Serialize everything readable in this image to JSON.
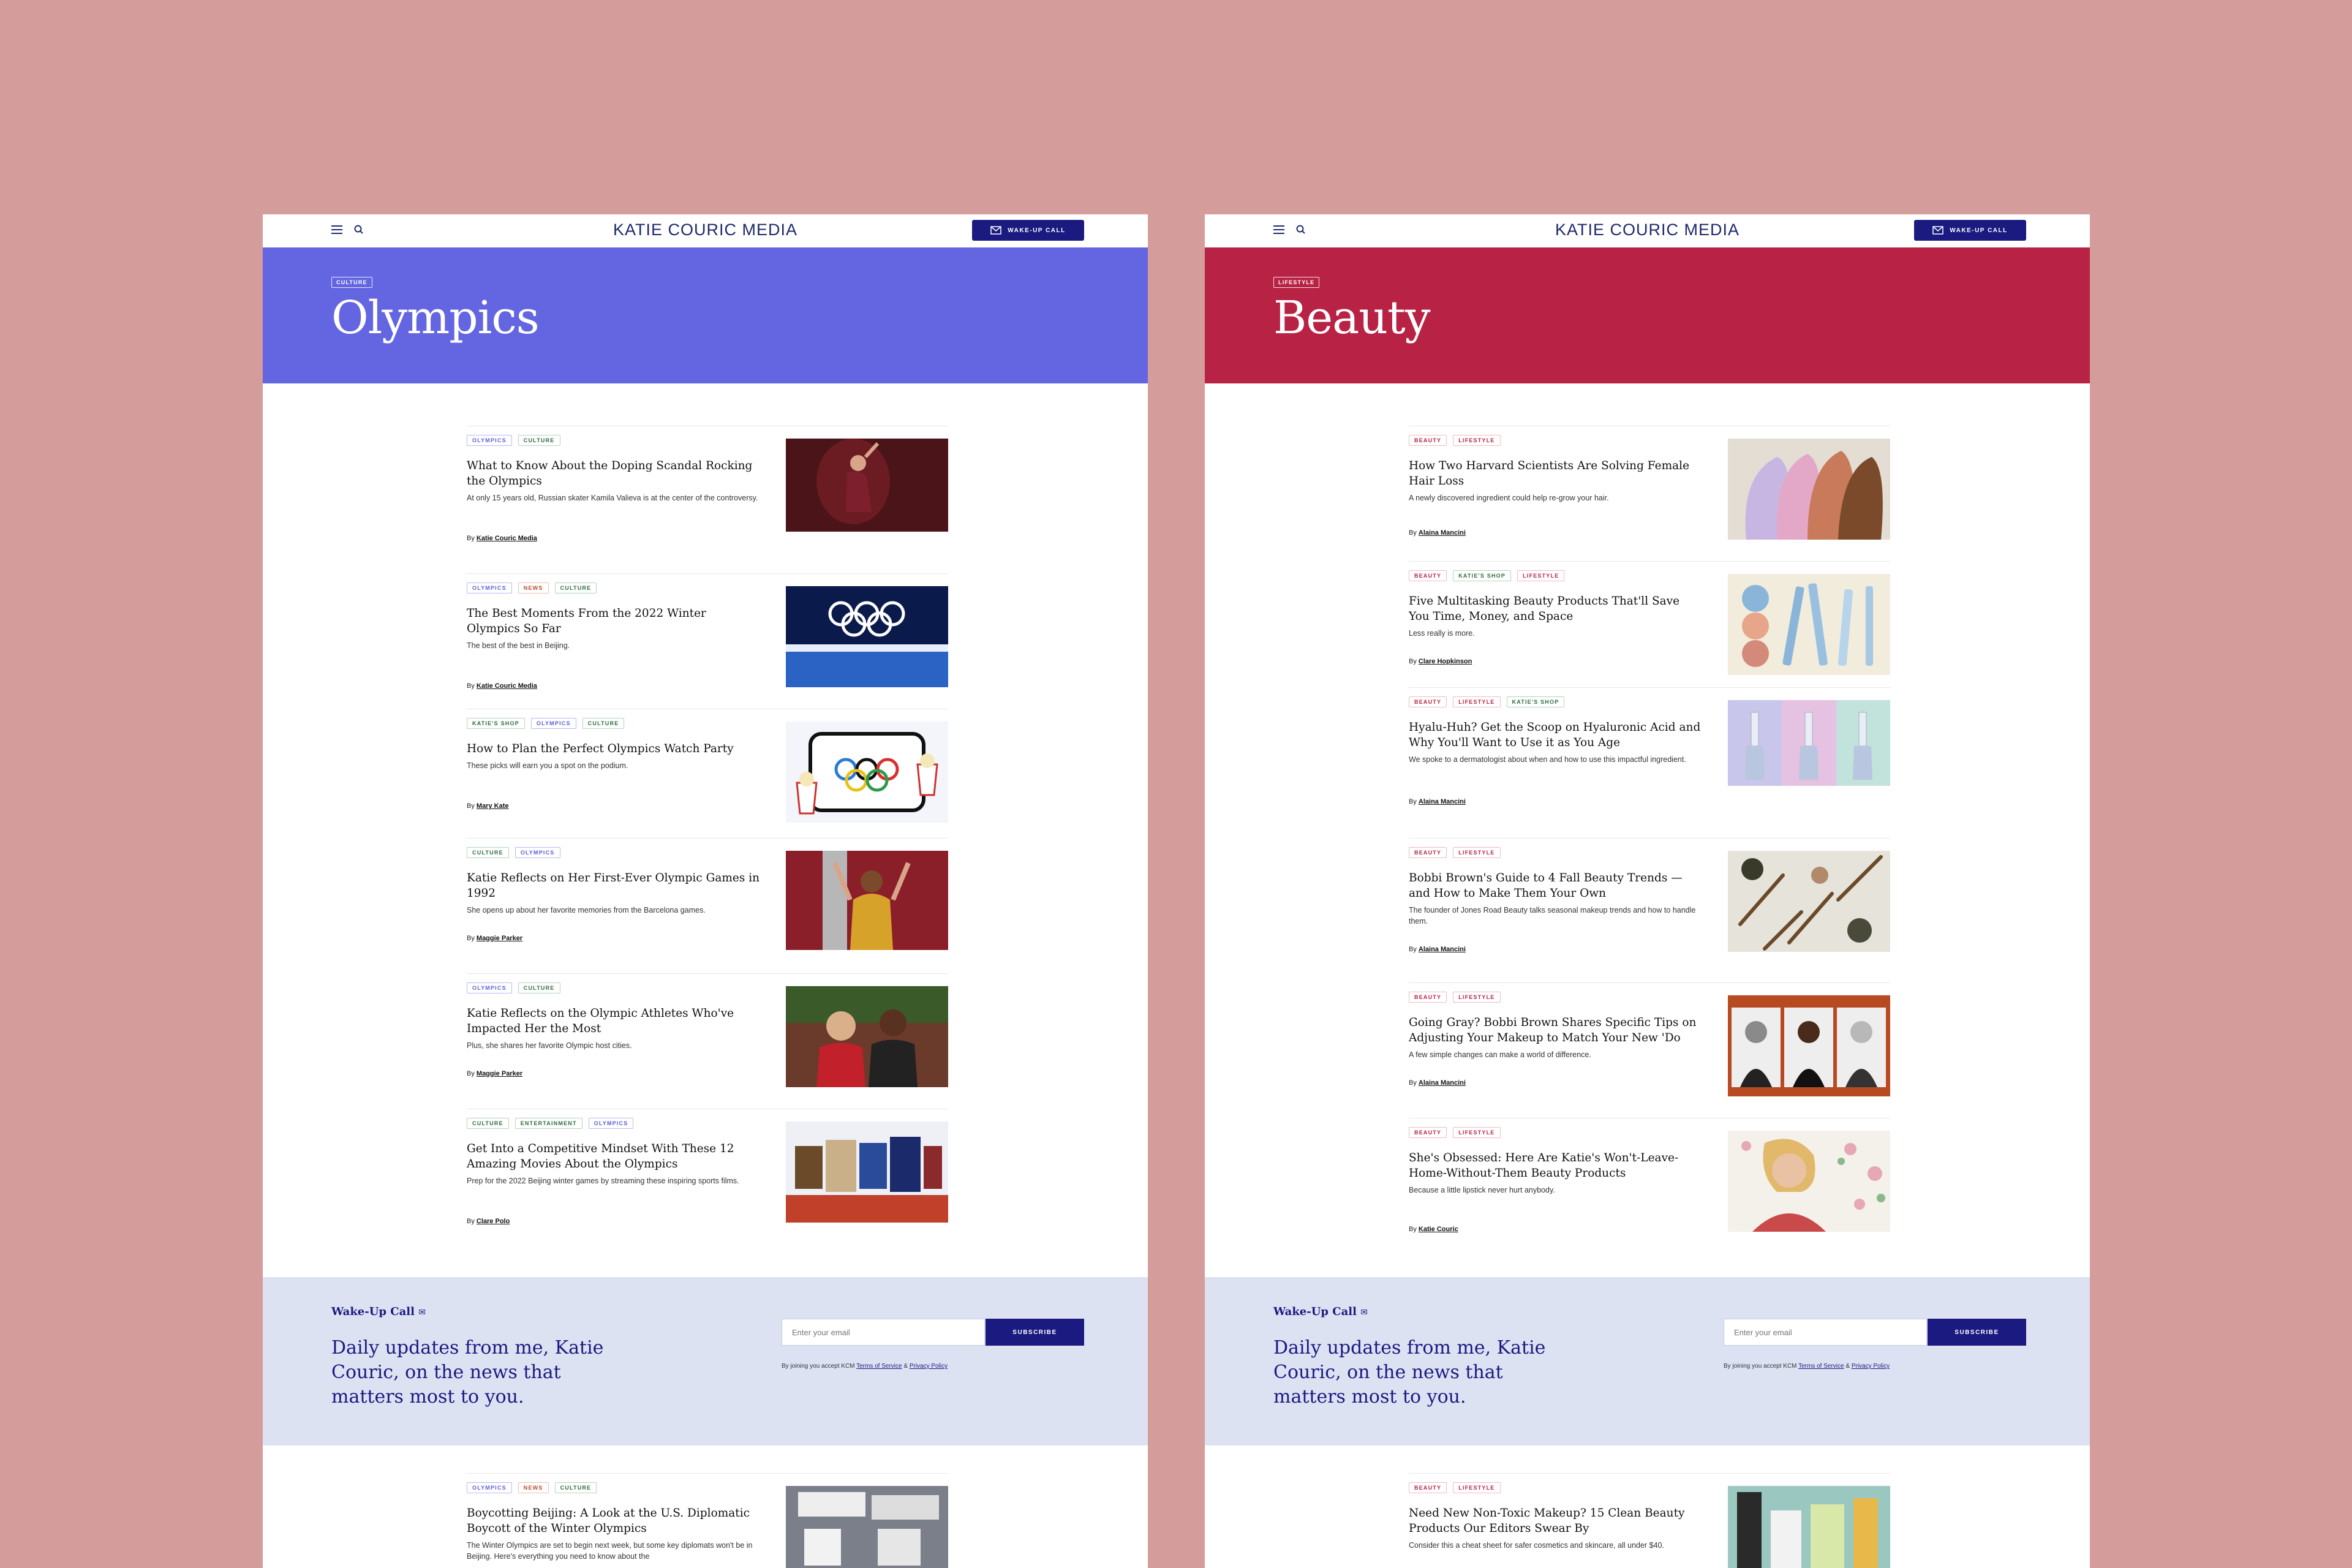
{
  "colors": {
    "background": "#d49c9a",
    "navy": "#1a1a80",
    "olympics_hero": "#6366e0",
    "beauty_hero": "#b82345",
    "newsletter_bg": "#dde2f3"
  },
  "pages": [
    {
      "brand": "KATIE COURIC MEDIA",
      "wake_up_button": "WAKE-UP CALL",
      "hero": {
        "tag": "CULTURE",
        "title": "Olympics",
        "color": "#6366e0"
      },
      "articles": [
        {
          "tags": [
            "OLYMPICS",
            "CULTURE"
          ],
          "title": "What to Know About the Doping Scandal Rocking the Olympics",
          "desc": "At only 15 years old, Russian skater Kamila Valieva is at the center of the controversy.",
          "by": "By",
          "author": "Katie Couric Media",
          "image": "skater-photo"
        },
        {
          "tags": [
            "OLYMPICS",
            "NEWS",
            "CULTURE"
          ],
          "title": "The Best Moments From the 2022 Winter Olympics So Far",
          "desc": "The best of the best in Beijing.",
          "by": "By",
          "author": "Katie Couric Media",
          "image": "olympic-rings-stadium-photo"
        },
        {
          "tags": [
            "KATIE'S SHOP",
            "OLYMPICS",
            "CULTURE"
          ],
          "title": "How to Plan the Perfect Olympics Watch Party",
          "desc": "These picks will earn you a spot on the podium.",
          "by": "By",
          "author": "Mary Kate",
          "image": "tv-popcorn-illustration"
        },
        {
          "tags": [
            "CULTURE",
            "OLYMPICS"
          ],
          "title": "Katie Reflects on Her First-Ever Olympic Games in 1992",
          "desc": "She opens up about her favorite memories from the Barcelona games.",
          "by": "By",
          "author": "Maggie Parker",
          "image": "katie-1992-photo"
        },
        {
          "tags": [
            "OLYMPICS",
            "CULTURE"
          ],
          "title": "Katie Reflects on the Olympic Athletes Who've Impacted Her the Most",
          "desc": "Plus, she shares her favorite Olympic host cities.",
          "by": "By",
          "author": "Maggie Parker",
          "image": "katie-athlete-photo"
        },
        {
          "tags": [
            "CULTURE",
            "ENTERTAINMENT",
            "OLYMPICS"
          ],
          "title": "Get Into a Competitive Mindset With These 12 Amazing Movies About the Olympics",
          "desc": "Prep for the 2022 Beijing winter games by streaming these inspiring sports films.",
          "by": "By",
          "author": "Clare Polo",
          "image": "movie-posters"
        }
      ],
      "newsletter": {
        "kicker": "Wake-Up Call",
        "heading": "Daily updates from me, Katie Couric, on the news that matters most to you.",
        "placeholder": "Enter your email",
        "button": "SUBSCRIBE",
        "terms_prefix": "By joining you accept KCM",
        "terms_link": "Terms of Service",
        "amp": "&",
        "privacy_link": "Privacy Policy"
      },
      "bottom_article": {
        "tags": [
          "OLYMPICS",
          "NEWS",
          "CULTURE"
        ],
        "title": "Boycotting Beijing: A Look at the U.S. Diplomatic Boycott of the Winter Olympics",
        "desc": "The Winter Olympics are set to begin next week, but some key diplomats won't be in Beijing. Here's everything you need to know about the",
        "image": "protest-photo"
      }
    },
    {
      "brand": "KATIE COURIC MEDIA",
      "wake_up_button": "WAKE-UP CALL",
      "hero": {
        "tag": "LIFESTYLE",
        "title": "Beauty",
        "color": "#b82345"
      },
      "articles": [
        {
          "tags": [
            "BEAUTY",
            "LIFESTYLE"
          ],
          "title": "How Two Harvard Scientists Are Solving Female Hair Loss",
          "desc": "A newly discovered ingredient could help re-grow your hair.",
          "by": "By",
          "author": "Alaina Mancini",
          "image": "women-profiles-illustration"
        },
        {
          "tags": [
            "BEAUTY",
            "KATIE'S SHOP",
            "LIFESTYLE"
          ],
          "title": "Five Multitasking Beauty Products That'll Save You Time, Money, and Space",
          "desc": "Less really is more.",
          "by": "By",
          "author": "Clare Hopkinson",
          "image": "makeup-products-photo"
        },
        {
          "tags": [
            "BEAUTY",
            "LIFESTYLE",
            "KATIE'S SHOP"
          ],
          "title": "Hyalu-Huh? Get the Scoop on Hyaluronic Acid and Why You'll Want to Use it as You Age",
          "desc": "We spoke to a dermatologist about when and how to use this impactful ingredient.",
          "by": "By",
          "author": "Alaina Mancini",
          "image": "serum-droppers-photo"
        },
        {
          "tags": [
            "BEAUTY",
            "LIFESTYLE"
          ],
          "title": "Bobbi Brown's Guide to 4 Fall Beauty Trends — and How to Make Them Your Own",
          "desc": "The founder of Jones Road Beauty talks seasonal makeup trends and how to handle them.",
          "by": "By",
          "author": "Alaina Mancini",
          "image": "brushes-photo"
        },
        {
          "tags": [
            "BEAUTY",
            "LIFESTYLE"
          ],
          "title": "Going Gray? Bobbi Brown Shares Specific Tips on Adjusting Your Makeup to Match Your New 'Do",
          "desc": "A few simple changes can make a world of difference.",
          "by": "By",
          "author": "Alaina Mancini",
          "image": "three-women-photo"
        },
        {
          "tags": [
            "BEAUTY",
            "LIFESTYLE"
          ],
          "title": "She's Obsessed: Here Are Katie's Won't-Leave-Home-Without-Them Beauty Products",
          "desc": "Because a little lipstick never hurt anybody.",
          "by": "By",
          "author": "Katie Couric",
          "image": "katie-floral-photo"
        }
      ],
      "newsletter": {
        "kicker": "Wake-Up Call",
        "heading": "Daily updates from me, Katie Couric, on the news that matters most to you.",
        "placeholder": "Enter your email",
        "button": "SUBSCRIBE",
        "terms_prefix": "By joining you accept KCM",
        "terms_link": "Terms of Service",
        "amp": "&",
        "privacy_link": "Privacy Policy"
      },
      "bottom_article": {
        "tags": [
          "BEAUTY",
          "LIFESTYLE"
        ],
        "title": "Need New Non-Toxic Makeup? 15 Clean Beauty Products Our Editors Swear By",
        "desc": "Consider this a cheat sheet for safer cosmetics and skincare, all under $40.",
        "image": "clean-beauty-products-photo"
      }
    }
  ]
}
